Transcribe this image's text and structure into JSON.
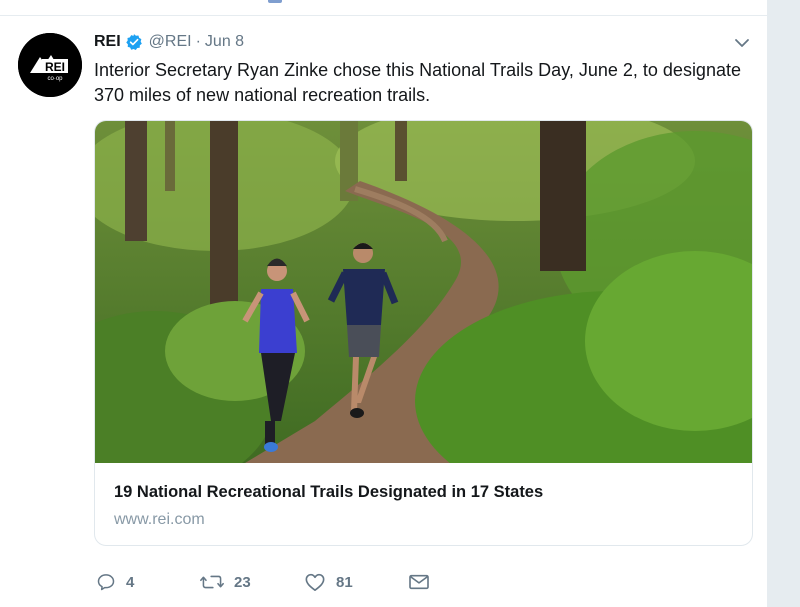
{
  "tweet": {
    "author_name": "REI",
    "handle": "@REI",
    "separator": "·",
    "date": "Jun 8",
    "text": "Interior Secretary Ryan Zinke chose this National Trails Day, June 2, to designate 370 miles of new national recreation trails.",
    "avatar_logo_text": "REI",
    "avatar_logo_subtext": "co·op"
  },
  "link_card": {
    "title": "19 National Recreational Trails Designated in 17 States",
    "domain": "www.rei.com"
  },
  "actions": {
    "reply_count": "4",
    "retweet_count": "23",
    "like_count": "81"
  },
  "icons": {
    "verified": "verified-badge-icon",
    "caret": "chevron-down-icon",
    "reply": "reply-icon",
    "retweet": "retweet-icon",
    "like": "heart-icon",
    "dm": "envelope-icon"
  },
  "colors": {
    "verified_blue": "#1da1f2",
    "muted_text": "#657786",
    "link_domain": "#8899a6"
  }
}
